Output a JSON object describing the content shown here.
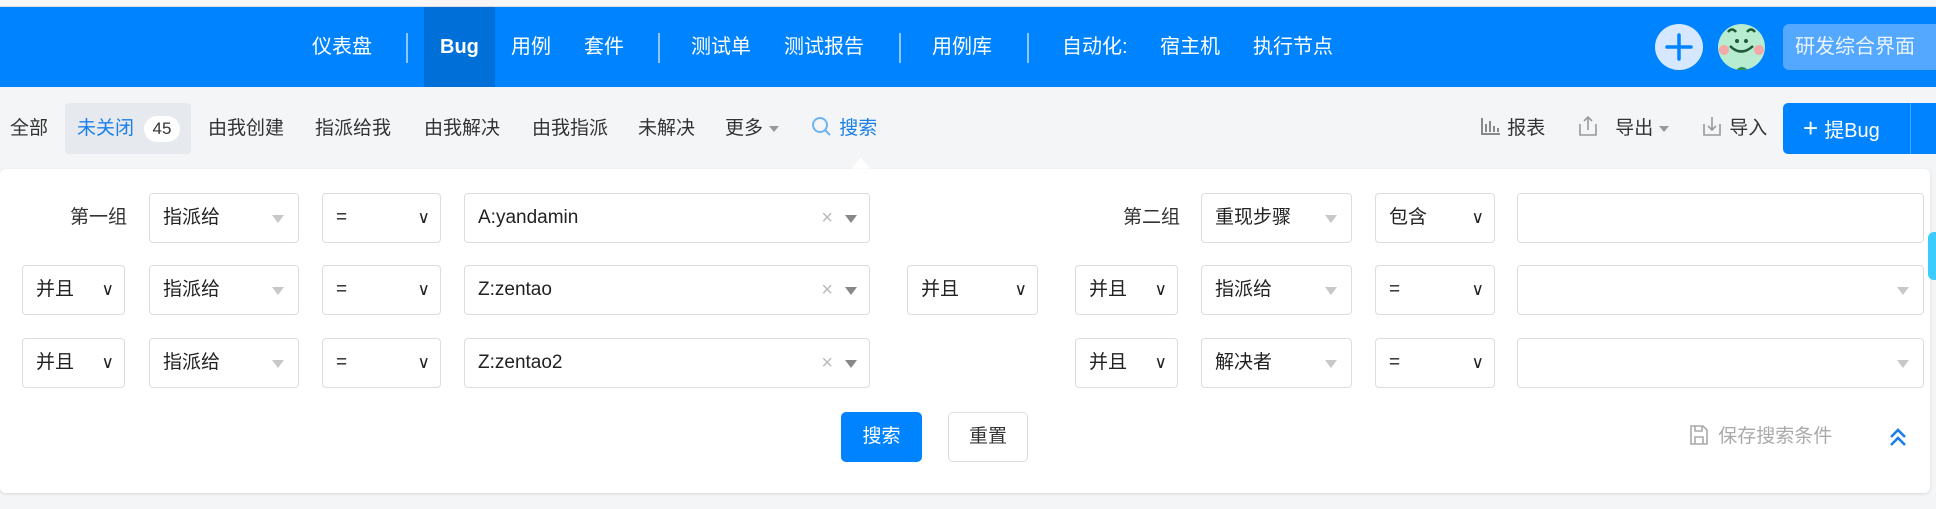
{
  "nav": {
    "items": [
      "仪表盘",
      "Bug",
      "用例",
      "套件",
      "测试单",
      "测试报告",
      "用例库",
      "自动化:",
      "宿主机",
      "执行节点"
    ],
    "active": "Bug",
    "workspace_label": "研发综合界面",
    "brand_color": "#0083ff"
  },
  "toolbar": {
    "tabs": [
      "全部",
      "未关闭",
      "由我创建",
      "指派给我",
      "由我解决",
      "由我指派",
      "未解决",
      "更多",
      "搜索"
    ],
    "open_count": "45",
    "report": "报表",
    "export": "导出",
    "import": "导入",
    "submit_bug": "提Bug"
  },
  "search": {
    "group1_label": "第一组",
    "group2_label": "第二组",
    "group1": [
      {
        "logic": "",
        "field": "指派给",
        "op": "=",
        "value": "A:yandamin"
      },
      {
        "logic": "并且",
        "field": "指派给",
        "op": "=",
        "value": "Z:zentao"
      },
      {
        "logic": "并且",
        "field": "指派给",
        "op": "=",
        "value": "Z:zentao2"
      }
    ],
    "group_logic": "并且",
    "group2": [
      {
        "logic": "",
        "field": "重现步骤",
        "op": "包含",
        "value": ""
      },
      {
        "logic": "并且",
        "field": "指派给",
        "op": "=",
        "value": ""
      },
      {
        "logic": "并且",
        "field": "解决者",
        "op": "=",
        "value": ""
      }
    ],
    "search_button": "搜索",
    "reset_button": "重置",
    "save_condition": "保存搜索条件"
  }
}
